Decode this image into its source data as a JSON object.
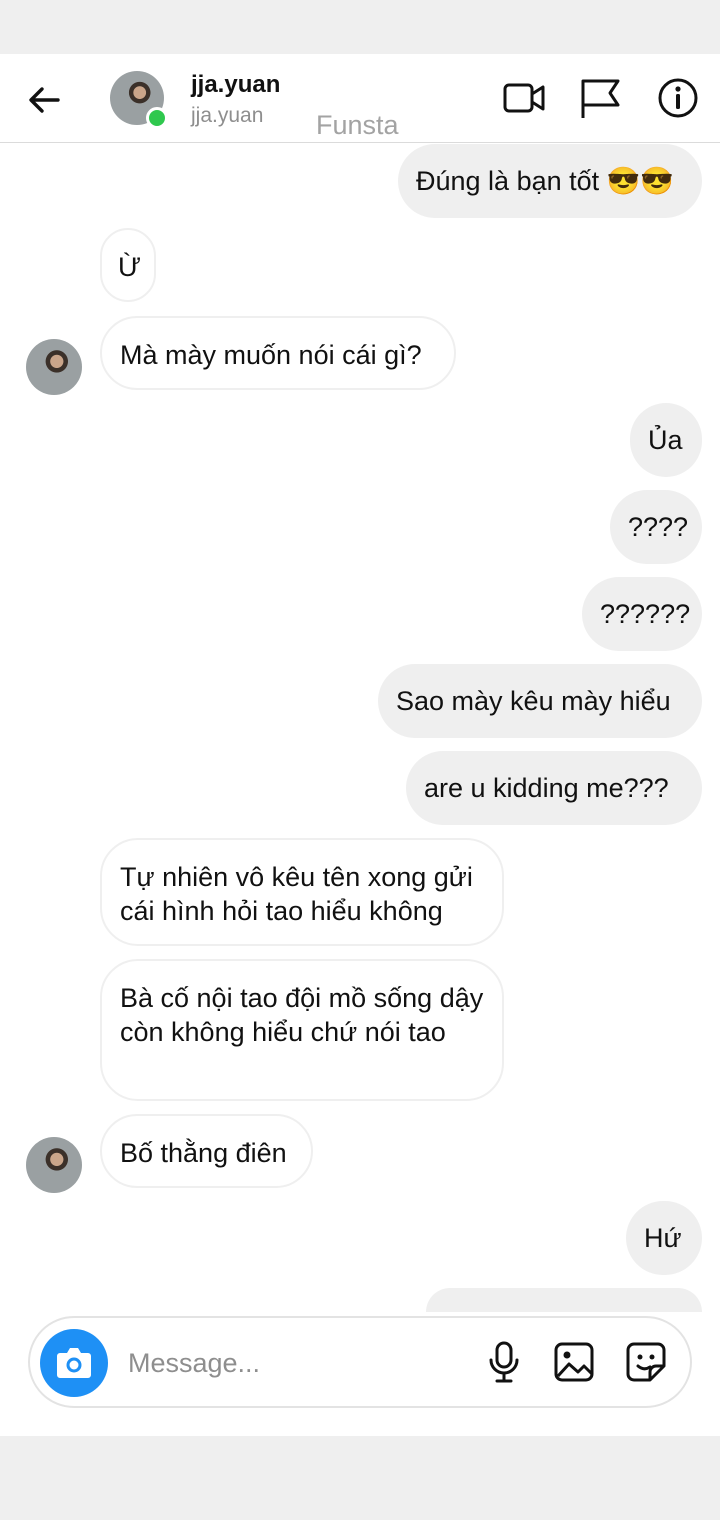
{
  "header": {
    "username": "jja.yuan",
    "subname": "jja.yuan",
    "tag": "Funsta",
    "icons": [
      "back-arrow-icon",
      "video-call-icon",
      "flag-icon",
      "info-icon"
    ]
  },
  "messages": [
    {
      "side": "out",
      "text": "Đúng là bạn tốt 😎😎"
    },
    {
      "side": "in",
      "text": "Ừ"
    },
    {
      "side": "in",
      "text": "Mà mày muốn nói cái gì?"
    },
    {
      "side": "out",
      "text": "Ủa"
    },
    {
      "side": "out",
      "text": "????"
    },
    {
      "side": "out",
      "text": "??????"
    },
    {
      "side": "out",
      "text": "Sao mày kêu mày hiểu"
    },
    {
      "side": "out",
      "text": "are u kidding me???"
    },
    {
      "side": "in",
      "text": "Tự nhiên vô kêu tên xong gửi cái hình hỏi tao hiểu không"
    },
    {
      "side": "in",
      "text": "Bà cố nội tao đội mồ sống dậy còn không hiểu chứ nói tao"
    },
    {
      "side": "in",
      "text": "Bố thằng điên"
    },
    {
      "side": "out",
      "text": "Hứ"
    }
  ],
  "composer": {
    "placeholder": "Message...",
    "icons": [
      "camera-icon",
      "microphone-icon",
      "gallery-icon",
      "sticker-icon"
    ]
  },
  "colors": {
    "accent": "#1e90f5",
    "online": "#2fc84e",
    "outgoing_bubble": "#efefef"
  }
}
